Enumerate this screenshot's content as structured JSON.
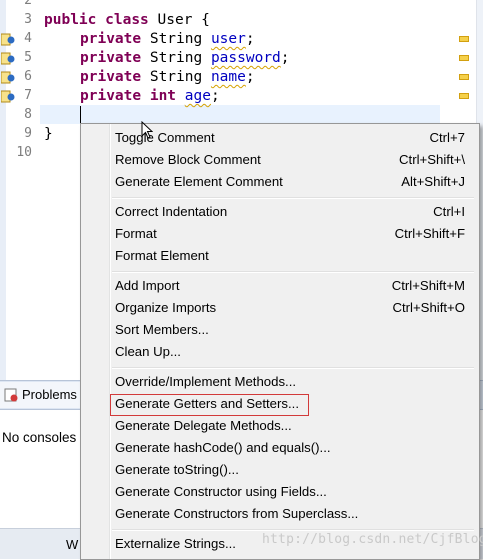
{
  "editor": {
    "line_numbers": [
      "2",
      "3",
      "4",
      "5",
      "6",
      "7",
      "8",
      "9",
      "10"
    ],
    "class_line": {
      "kw1": "public",
      "kw2": "class",
      "name": " User {"
    },
    "fields": [
      {
        "mod": "private",
        "type": " String ",
        "name": "user",
        "end": ";"
      },
      {
        "mod": "private",
        "type": " String ",
        "name": "password",
        "end": ";"
      },
      {
        "mod": "private",
        "type": " String ",
        "name": "name",
        "end": ";"
      },
      {
        "mod": "private",
        "type": " ",
        "int": "int",
        "name": "age",
        "end": ";"
      }
    ],
    "close_brace": "}"
  },
  "bottom_panel": {
    "tab_problems": "Problems",
    "no_consoles": "No consoles t",
    "status_w": "W"
  },
  "context_menu": {
    "groups": [
      [
        {
          "label": "Toggle Comment",
          "shortcut": "Ctrl+7"
        },
        {
          "label": "Remove Block Comment",
          "shortcut": "Ctrl+Shift+\\"
        },
        {
          "label": "Generate Element Comment",
          "shortcut": "Alt+Shift+J"
        }
      ],
      [
        {
          "label": "Correct Indentation",
          "shortcut": "Ctrl+I"
        },
        {
          "label": "Format",
          "shortcut": "Ctrl+Shift+F"
        },
        {
          "label": "Format Element",
          "shortcut": ""
        }
      ],
      [
        {
          "label": "Add Import",
          "shortcut": "Ctrl+Shift+M"
        },
        {
          "label": "Organize Imports",
          "shortcut": "Ctrl+Shift+O"
        },
        {
          "label": "Sort Members...",
          "shortcut": ""
        },
        {
          "label": "Clean Up...",
          "shortcut": ""
        }
      ],
      [
        {
          "label": "Override/Implement Methods...",
          "shortcut": ""
        },
        {
          "label": "Generate Getters and Setters...",
          "shortcut": ""
        },
        {
          "label": "Generate Delegate Methods...",
          "shortcut": ""
        },
        {
          "label": "Generate hashCode() and equals()...",
          "shortcut": ""
        },
        {
          "label": "Generate toString()...",
          "shortcut": ""
        },
        {
          "label": "Generate Constructor using Fields...",
          "shortcut": ""
        },
        {
          "label": "Generate Constructors from Superclass...",
          "shortcut": ""
        }
      ],
      [
        {
          "label": "Externalize Strings...",
          "shortcut": ""
        }
      ]
    ]
  },
  "watermark": "http://blog.csdn.net/CjfBlog",
  "colors": {
    "keyword": "#7f0055",
    "field": "#0000c0",
    "highlight_border": "#d23a3a"
  }
}
